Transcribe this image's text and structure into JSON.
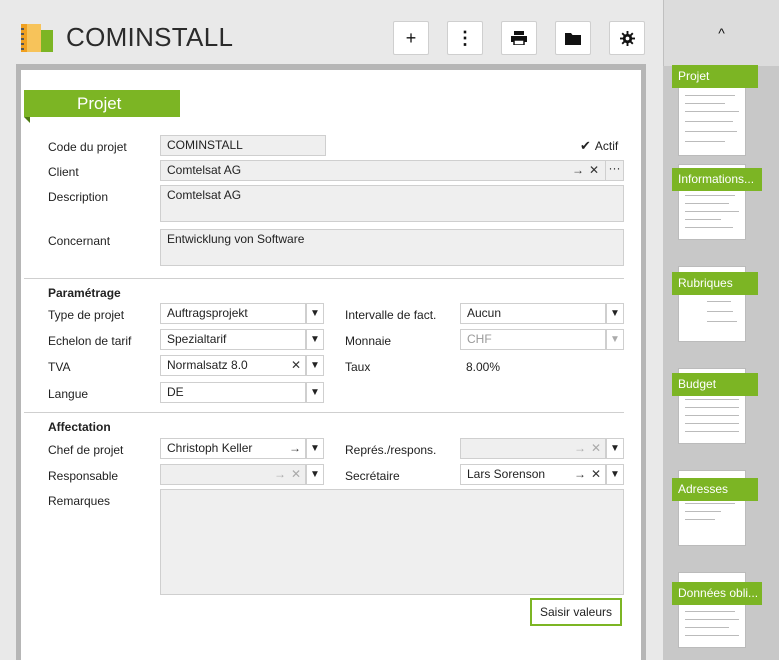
{
  "app": {
    "title": "COMINSTALL"
  },
  "toolbar": {
    "add_icon": "+",
    "more_icon": "⋮",
    "print_icon": "print-icon",
    "folder_icon": "folder-icon",
    "settings_icon": "gear-icon"
  },
  "section_title": "Projet",
  "fields": {
    "code_label": "Code du projet",
    "code_value": "COMINSTALL",
    "actif_label": "Actif",
    "client_label": "Client",
    "client_value": "Comtelsat AG",
    "description_label": "Description",
    "description_value": "Comtelsat AG",
    "concernant_label": "Concernant",
    "concernant_value": "Entwicklung von Software"
  },
  "parametrage": {
    "heading": "Paramétrage",
    "type_label": "Type de projet",
    "type_value": "Auftragsprojekt",
    "echelon_label": "Echelon de tarif",
    "echelon_value": "Spezialtarif",
    "tva_label": "TVA",
    "tva_value": "Normalsatz 8.0",
    "langue_label": "Langue",
    "langue_value": "DE",
    "intervalle_label": "Intervalle de fact.",
    "intervalle_value": "Aucun",
    "monnaie_label": "Monnaie",
    "monnaie_value": "CHF",
    "taux_label": "Taux",
    "taux_value": "8.00%"
  },
  "affectation": {
    "heading": "Affectation",
    "chef_label": "Chef de projet",
    "chef_value": "Christoph Keller",
    "responsable_label": "Responsable",
    "responsable_value": "",
    "repres_label": "Représ./respons.",
    "repres_value": "",
    "secretaire_label": "Secrétaire",
    "secretaire_value": "Lars Sorenson",
    "remarques_label": "Remarques",
    "remarques_value": "",
    "saisir_button": "Saisir valeurs"
  },
  "sidebar": {
    "up_icon": "^",
    "items": [
      {
        "label": "Projet"
      },
      {
        "label": "Informations..."
      },
      {
        "label": "Rubriques"
      },
      {
        "label": "Budget"
      },
      {
        "label": "Adresses"
      },
      {
        "label": "Données obli..."
      }
    ]
  },
  "colors": {
    "accent": "#7cb524"
  }
}
